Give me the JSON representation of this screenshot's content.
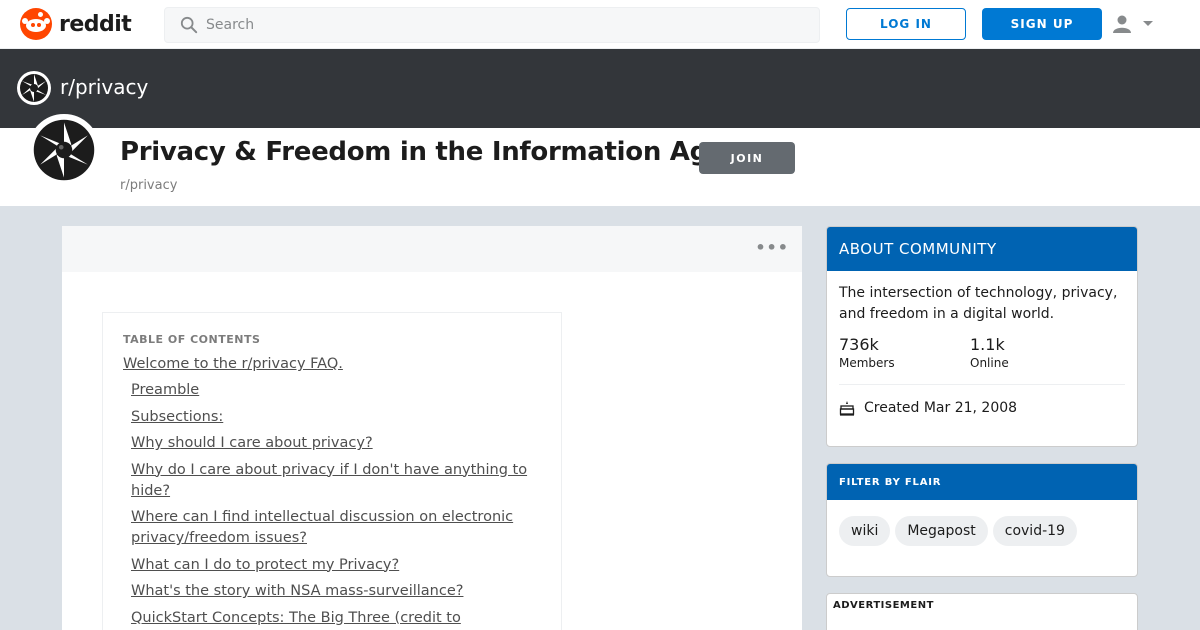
{
  "header": {
    "brand": "reddit",
    "search_placeholder": "Search",
    "login_label": "LOG IN",
    "signup_label": "SIGN UP",
    "icons": [
      "reddit-logo-icon",
      "search-icon",
      "user-icon",
      "caret-down-icon"
    ]
  },
  "banner": {
    "title": "r/privacy"
  },
  "subreddit": {
    "title": "Privacy & Freedom in the Information Age",
    "name": "r/privacy",
    "join_label": "JOIN"
  },
  "toc": {
    "heading": "TABLE OF CONTENTS",
    "items": [
      {
        "label": "Welcome to the r/privacy FAQ.",
        "level": 1
      },
      {
        "label": "Preamble",
        "level": 2
      },
      {
        "label": "Subsections:",
        "level": 2
      },
      {
        "label": "Why should I care about privacy?",
        "level": 2
      },
      {
        "label": "Why do I care about privacy if I don't have anything to hide?",
        "level": 2
      },
      {
        "label": "Where can I find intellectual discussion on electronic privacy/freedom issues?",
        "level": 2
      },
      {
        "label": "What can I do to protect my Privacy?",
        "level": 2
      },
      {
        "label": "What's the story with NSA mass-surveillance?",
        "level": 2
      },
      {
        "label": "QuickStart Concepts: The Big Three (credit to",
        "level": 2
      }
    ]
  },
  "about": {
    "heading": "ABOUT COMMUNITY",
    "description": "The intersection of technology, privacy, and freedom in a digital world.",
    "members_count": "736k",
    "members_label": "Members",
    "online_count": "1.1k",
    "online_label": "Online",
    "created": "Created Mar 21, 2008"
  },
  "flair": {
    "heading": "FILTER BY FLAIR",
    "items": [
      "wiki",
      "Megapost",
      "covid-19"
    ]
  },
  "ad": {
    "label": "ADVERTISEMENT"
  },
  "colors": {
    "brand": "#ff4500",
    "primary": "#0079d3",
    "sidebar_header": "#0063b2",
    "banner": "#33363a",
    "join_button": "#646a70"
  }
}
